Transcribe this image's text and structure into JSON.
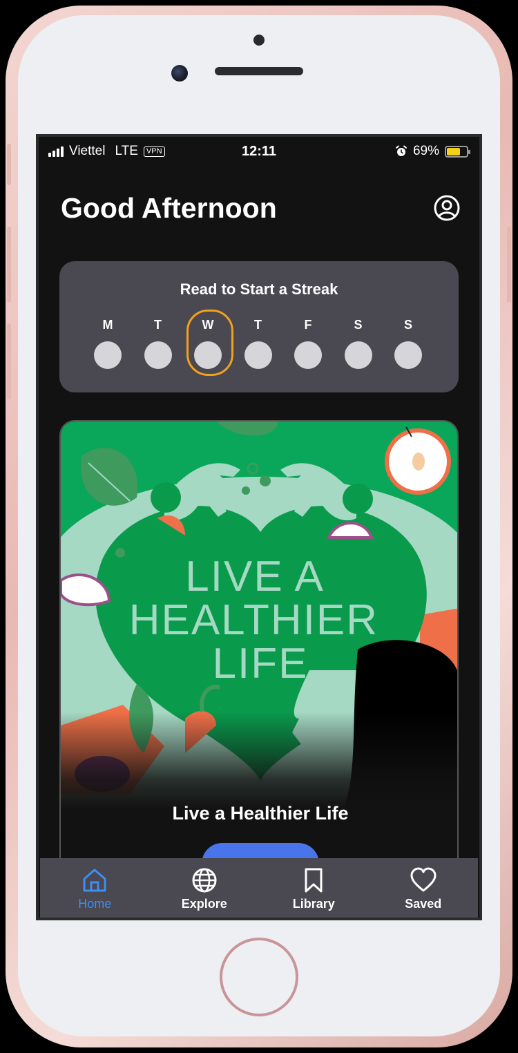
{
  "status_bar": {
    "carrier": "Viettel",
    "network": "LTE",
    "vpn": "VPN",
    "time": "12:11",
    "battery": "69%",
    "battery_level": 0.69,
    "alarm_icon": "alarm-icon",
    "signal_icon": "signal-bars-icon"
  },
  "header": {
    "greeting": "Good Afternoon",
    "profile_icon": "user-circle-icon"
  },
  "streak": {
    "title": "Read to Start a Streak",
    "days": [
      "M",
      "T",
      "W",
      "T",
      "F",
      "S",
      "S"
    ],
    "current_day": "W"
  },
  "featured_book": {
    "cover_text": [
      "LIVE A",
      "HEALTHIER",
      "LIFE"
    ],
    "title": "Live a Healthier Life"
  },
  "tab_bar": {
    "tabs": [
      {
        "label": "Home",
        "icon": "home-icon",
        "active": true
      },
      {
        "label": "Explore",
        "icon": "globe-icon",
        "active": false
      },
      {
        "label": "Library",
        "icon": "bookmark-icon",
        "active": false
      },
      {
        "label": "Saved",
        "icon": "heart-icon",
        "active": false
      }
    ]
  },
  "colors": {
    "background": "#121212",
    "card": "#4a4850",
    "accent": "#3d8ef5",
    "streak_highlight": "#f2a11e",
    "cover_green": "#079a4d"
  }
}
